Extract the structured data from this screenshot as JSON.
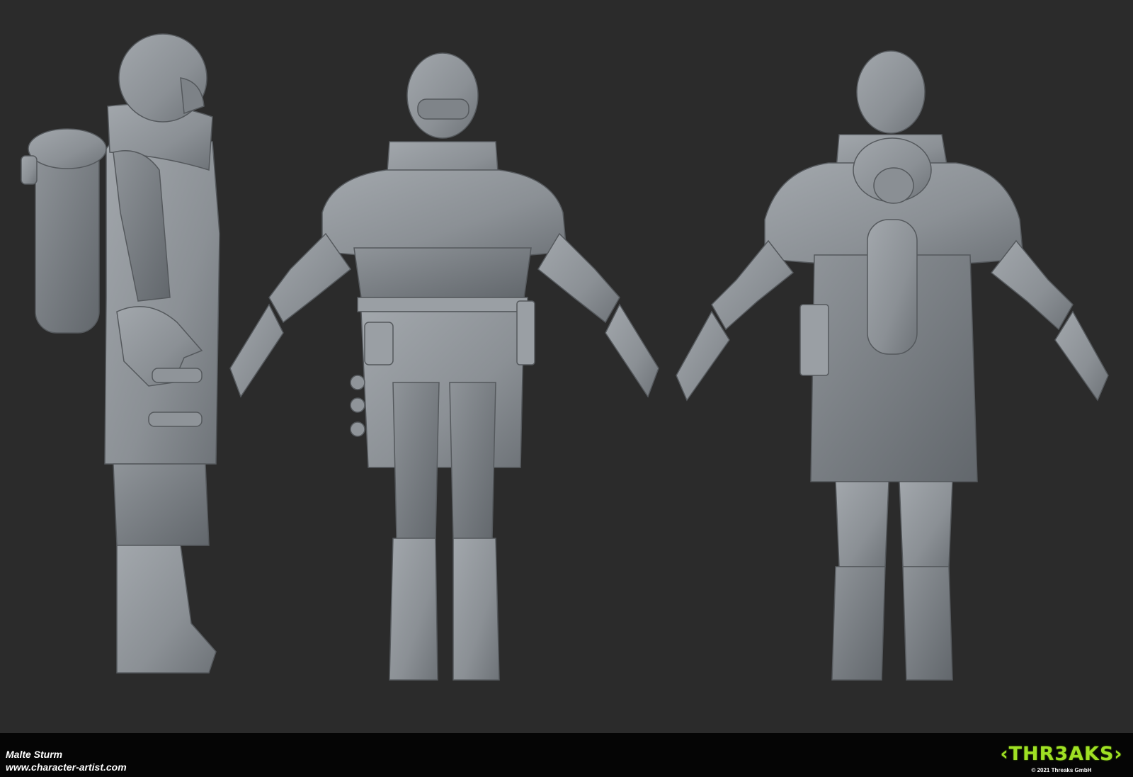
{
  "footer": {
    "artist": "Malte Sturm",
    "website": "www.character-artist.com",
    "logo_text": "‹THR3AKS›",
    "copyright": "© 2021 Threaks GmbH"
  },
  "colors": {
    "background": "#2b2b2b",
    "footer": "#050505",
    "sculpt": "#8c9196",
    "logo": "#9fe024"
  },
  "views": [
    "side",
    "front",
    "back"
  ]
}
